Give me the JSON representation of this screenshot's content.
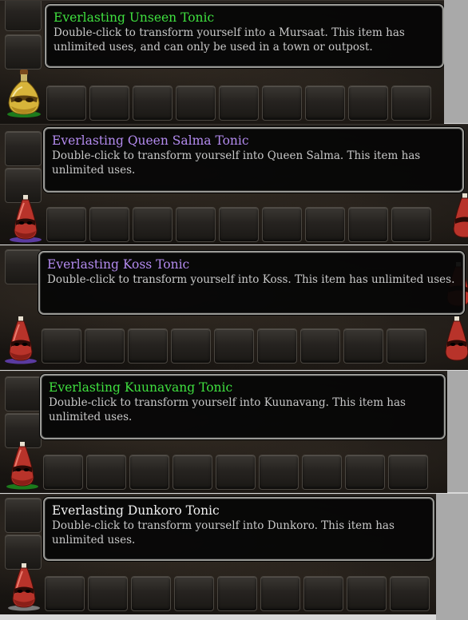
{
  "tooltips": [
    {
      "title": "Everlasting Unseen Tonic",
      "description": "Double-click to transform yourself into a Mursaat. This item has unlimited uses, and can only be used in a town or outpost.",
      "title_color": "#3fe03f"
    },
    {
      "title": "Everlasting Queen Salma Tonic",
      "description": "Double-click to transform yourself into Queen Salma. This item has unlimited uses.",
      "title_color": "#b48bf0"
    },
    {
      "title": "Everlasting Koss Tonic",
      "description": "Double-click to transform yourself into Koss. This item has unlimited uses.",
      "title_color": "#b48bf0"
    },
    {
      "title": "Everlasting Kuunavang Tonic",
      "description": "Double-click to transform yourself into Kuunavang. This item has unlimited uses.",
      "title_color": "#3fe03f"
    },
    {
      "title": "Everlasting Dunkoro Tonic",
      "description": "Double-click to transform yourself into Dunkoro. This item has unlimited uses.",
      "title_color": "#f2f2f2"
    }
  ],
  "icons": {
    "gold_tonic": "tonic-bottle-gold-icon",
    "red_tonic": "tonic-bottle-red-icon"
  },
  "colors": {
    "rarity_green": "#1f9a1f",
    "rarity_purple": "#6a3fb0",
    "rarity_white": "#bdbdbd"
  }
}
